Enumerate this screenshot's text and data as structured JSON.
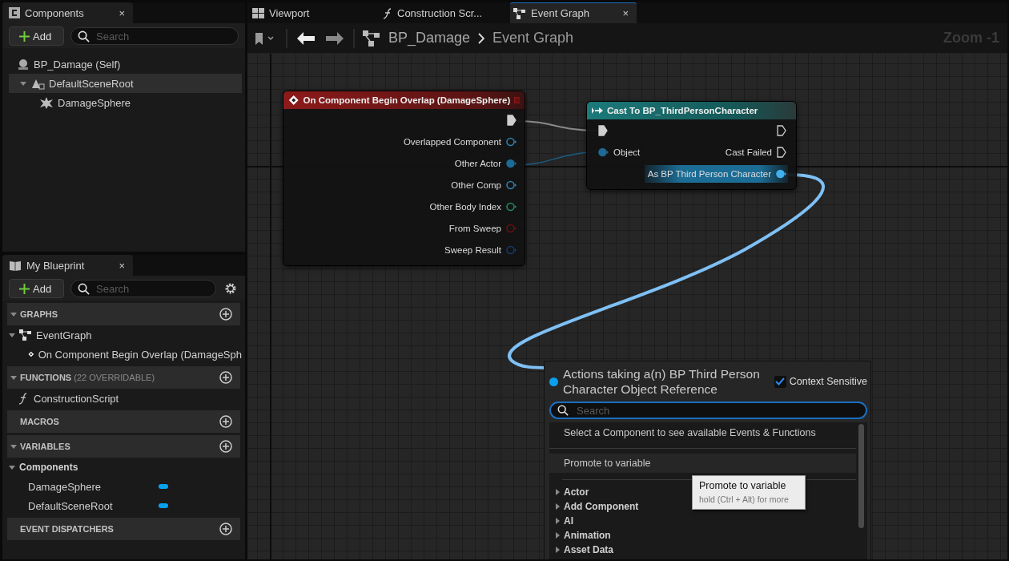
{
  "components_panel": {
    "tab": {
      "title": "Components",
      "kind": "components",
      "close": "×"
    },
    "add_button": "Add",
    "search": {
      "placeholder": "Search"
    },
    "tree": [
      {
        "label": "BP_Damage (Self)",
        "kind": "actor",
        "selected": false,
        "children": [
          {
            "label": "DefaultSceneRoot",
            "kind": "scene",
            "selected": true,
            "expanded": true,
            "children": [
              {
                "label": "DamageSphere",
                "kind": "sphere",
                "selected": false
              }
            ]
          }
        ]
      }
    ]
  },
  "my_blueprint": {
    "tab": {
      "title": "My Blueprint",
      "kind": "book",
      "close": "×"
    },
    "add_button": "Add",
    "search": {
      "placeholder": "Search"
    },
    "sections": [
      {
        "title": "GRAPHS",
        "expanded": true,
        "items": [
          {
            "label": "EventGraph",
            "kind": "graph",
            "expanded": true,
            "children": [
              {
                "label": "On Component Begin Overlap (DamageSph",
                "kind": "event"
              }
            ]
          }
        ]
      },
      {
        "title": "FUNCTIONS",
        "note": "(22 OVERRIDABLE)",
        "expanded": true,
        "items": [
          {
            "label": "ConstructionScript",
            "kind": "function"
          }
        ]
      },
      {
        "title": "MACROS"
      },
      {
        "title": "VARIABLES",
        "expanded": true,
        "items": [
          {
            "label": "Components",
            "kind": "category",
            "expanded": true,
            "children": [
              {
                "label": "DamageSphere",
                "kind": "variable"
              },
              {
                "label": "DefaultSceneRoot",
                "kind": "variable"
              }
            ]
          }
        ]
      },
      {
        "title": "EVENT DISPATCHERS"
      }
    ]
  },
  "editor_tabs": [
    {
      "label": "Viewport",
      "kind": "viewport",
      "selected": false
    },
    {
      "label": "Construction Scr...",
      "kind": "function",
      "selected": false
    },
    {
      "label": "Event Graph",
      "kind": "graph",
      "selected": true,
      "close": "×"
    }
  ],
  "breadcrumb": {
    "items": [
      "BP_Damage",
      "Event Graph"
    ],
    "zoom": "Zoom -1"
  },
  "event_node": {
    "title": "On Component Begin Overlap (DamageSphere)",
    "outputs": [
      {
        "kind": "exec",
        "connected": true
      },
      {
        "kind": "data",
        "label": "Overlapped Component",
        "color": "#2f7fb0",
        "connected": false
      },
      {
        "kind": "data",
        "label": "Other Actor",
        "color": "#1e6a96",
        "connected": true
      },
      {
        "kind": "data",
        "label": "Other Comp",
        "color": "#2f7fb0",
        "connected": false
      },
      {
        "kind": "data",
        "label": "Other Body Index",
        "color": "#1f8a5a",
        "connected": false
      },
      {
        "kind": "data",
        "label": "From Sweep",
        "color": "#6a1010",
        "connected": false
      },
      {
        "kind": "data",
        "label": "Sweep Result",
        "color": "#153a6a",
        "connected": false
      }
    ]
  },
  "cast_node": {
    "title": "Cast To BP_ThirdPersonCharacter",
    "rows": [
      {
        "in": {
          "kind": "exec",
          "connected": true
        },
        "out": {
          "kind": "exec",
          "connected": false,
          "highlighted": false
        }
      },
      {
        "in": {
          "kind": "data",
          "label": "Object",
          "color": "#1e6a96",
          "connected": true
        },
        "out": {
          "kind": "exec",
          "label": "Cast Failed",
          "connected": false,
          "highlighted": false
        }
      },
      {
        "out": {
          "kind": "data",
          "label": "As BP Third Person Character",
          "color": "#3fb0f0",
          "connected": true,
          "highlighted": true
        }
      }
    ]
  },
  "action_menu": {
    "title": "Actions taking a(n) BP Third Person Character Object Reference",
    "context_sensitive": {
      "label": "Context Sensitive",
      "checked": true
    },
    "search": {
      "placeholder": "Search"
    },
    "info": "Select a Component to see available Events & Functions",
    "actions": [
      {
        "label": "Promote to variable",
        "hovered": true
      }
    ],
    "categories": [
      "Actor",
      "Add Component",
      "AI",
      "Animation",
      "Asset Data"
    ],
    "tooltip": {
      "title": "Promote to variable",
      "hint": "hold (Ctrl + Alt) for more"
    }
  }
}
